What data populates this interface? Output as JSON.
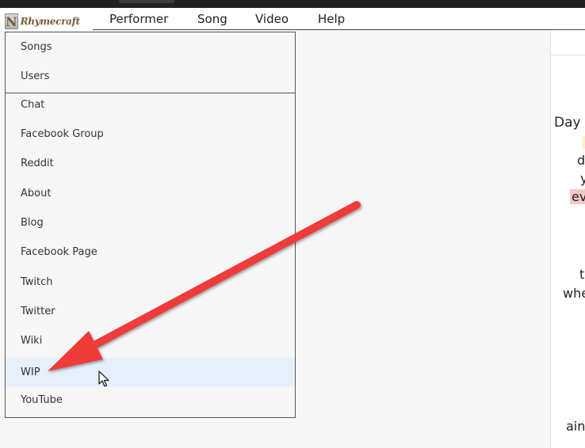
{
  "app": {
    "logo_text": "Rhymecraft",
    "logo_letter": "N"
  },
  "menubar": {
    "items": [
      "Performer",
      "Song",
      "Video",
      "Help"
    ]
  },
  "dropdown": {
    "group1": [
      "Songs",
      "Users"
    ],
    "group2": [
      "Chat",
      "Facebook Group",
      "Reddit",
      "About",
      "Blog",
      "Facebook Page",
      "Twitch",
      "Twitter",
      "Wiki",
      "WIP",
      "YouTube"
    ],
    "hovered": "WIP"
  },
  "content_fragments": {
    "day": "Day",
    "d": "d",
    "y": "y",
    "ev": "ev",
    "t": "t",
    "whe": "whe",
    "ain": "ain"
  },
  "colors": {
    "arrow": "#f03a3a",
    "hover_bg": "#e7effd",
    "highlight_red": "#f6c7c7"
  }
}
